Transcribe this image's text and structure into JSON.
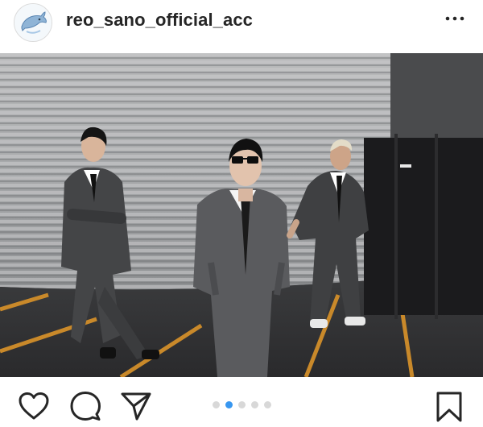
{
  "post": {
    "username": "reo_sano_official_acc",
    "avatar_icon": "dolphin-avatar-icon",
    "more_icon": "more-horizontal-icon"
  },
  "actions": {
    "like_icon": "heart-icon",
    "comment_icon": "comment-icon",
    "share_icon": "send-icon",
    "save_icon": "bookmark-icon"
  },
  "carousel": {
    "total_slides": 5,
    "active_index": 1,
    "active_color": "#3897f0",
    "inactive_color": "#d8d8d8"
  }
}
